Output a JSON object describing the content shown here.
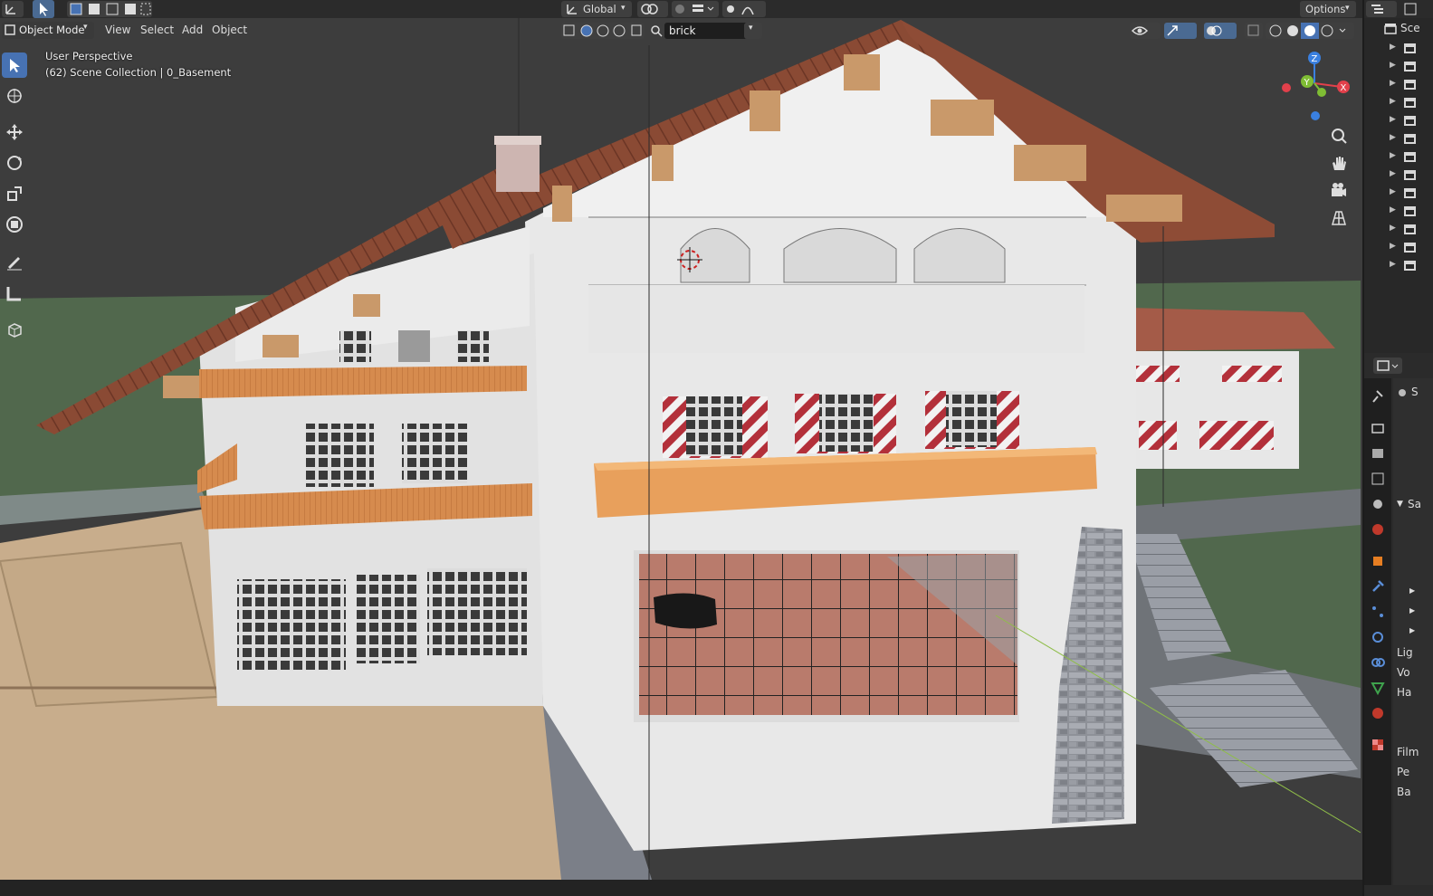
{
  "header": {
    "orientation": "Global",
    "options_label": "Options",
    "search_value": "brick",
    "scene_label": "Sce"
  },
  "menu": {
    "mode": "Object Mode",
    "items": [
      "View",
      "Select",
      "Add",
      "Object"
    ]
  },
  "viewport": {
    "perspective": "User Perspective",
    "collection": "(62) Scene Collection | 0_Basement"
  },
  "gizmo": {
    "axes": [
      "Z",
      "Y",
      "X"
    ],
    "colors": {
      "x": "#e2404b",
      "y": "#7fbd34",
      "z": "#3a80e0"
    }
  },
  "tools": [
    "select-box",
    "cursor",
    "move",
    "rotate",
    "scale",
    "transform",
    "annotate",
    "measure",
    "add-cube"
  ],
  "properties": {
    "object_label": "S",
    "section_label": "Sa",
    "labels": [
      "Lig",
      "Vo",
      "Ha",
      "Film",
      "Pe",
      "Ba"
    ]
  },
  "colors": {
    "accent": "#4772b3",
    "ground": "#51684d",
    "wall": "#e8e8e8",
    "roof": "#8b4a36",
    "balcony": "#e8a05c"
  }
}
